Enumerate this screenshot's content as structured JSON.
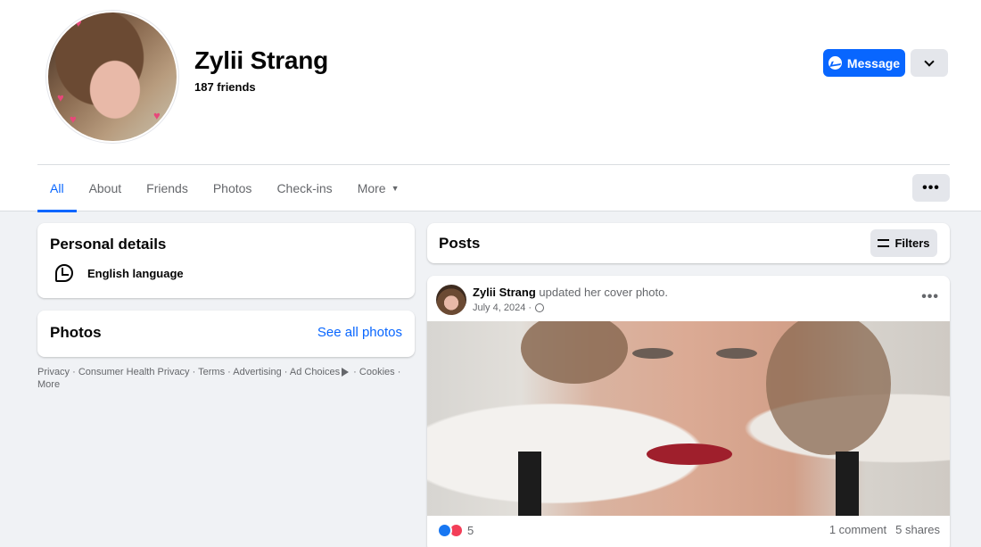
{
  "profile": {
    "name": "Zylii Strang",
    "friends_label": "187 friends"
  },
  "actions": {
    "message_label": "Message",
    "more_icon": "chevron-down-icon"
  },
  "tabs": [
    {
      "label": "All",
      "active": true
    },
    {
      "label": "About",
      "active": false
    },
    {
      "label": "Friends",
      "active": false
    },
    {
      "label": "Photos",
      "active": false
    },
    {
      "label": "Check-ins",
      "active": false
    },
    {
      "label": "More",
      "active": false
    }
  ],
  "tabs_overflow": "•••",
  "personal_details": {
    "title": "Personal details",
    "items": [
      {
        "icon": "language-icon",
        "label": "English language"
      }
    ]
  },
  "photos_card": {
    "title": "Photos",
    "see_all": "See all photos"
  },
  "footer": {
    "links": [
      "Privacy",
      "Consumer Health Privacy",
      "Terms",
      "Advertising",
      "Ad Choices",
      "Cookies",
      "More"
    ],
    "separator": " · "
  },
  "posts_card": {
    "title": "Posts",
    "filters_label": "Filters"
  },
  "post": {
    "author": "Zylii Strang",
    "action_text": " updated her cover photo.",
    "date": "July 4, 2024 ·",
    "more": "•••",
    "reaction_count": "5",
    "comments": "1 comment",
    "shares": "5 shares"
  },
  "colors": {
    "accent": "#0866ff",
    "background": "#f0f2f5",
    "secondary_text": "#65676b",
    "like": "#1877f2",
    "love": "#f33e58"
  }
}
